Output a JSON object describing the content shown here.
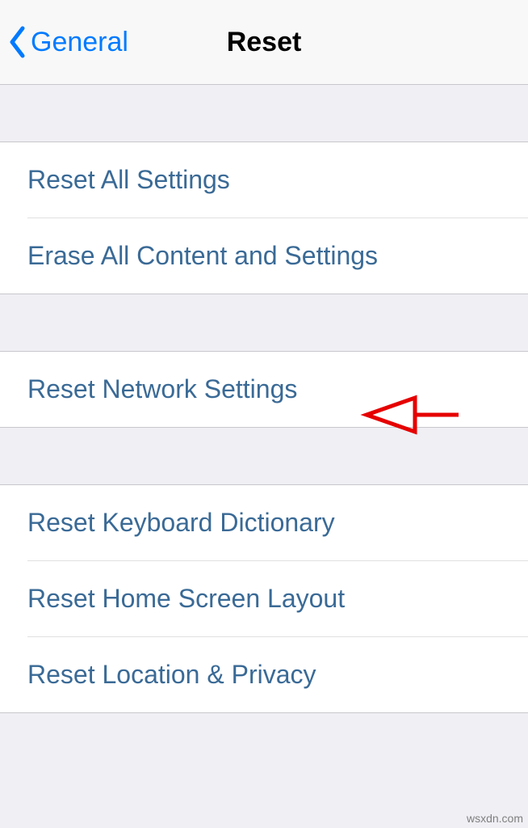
{
  "navbar": {
    "back_label": "General",
    "title": "Reset"
  },
  "groups": [
    {
      "items": [
        {
          "label": "Reset All Settings"
        },
        {
          "label": "Erase All Content and Settings"
        }
      ]
    },
    {
      "items": [
        {
          "label": "Reset Network Settings"
        }
      ]
    },
    {
      "items": [
        {
          "label": "Reset Keyboard Dictionary"
        },
        {
          "label": "Reset Home Screen Layout"
        },
        {
          "label": "Reset Location & Privacy"
        }
      ]
    }
  ],
  "watermark": "wsxdn.com"
}
